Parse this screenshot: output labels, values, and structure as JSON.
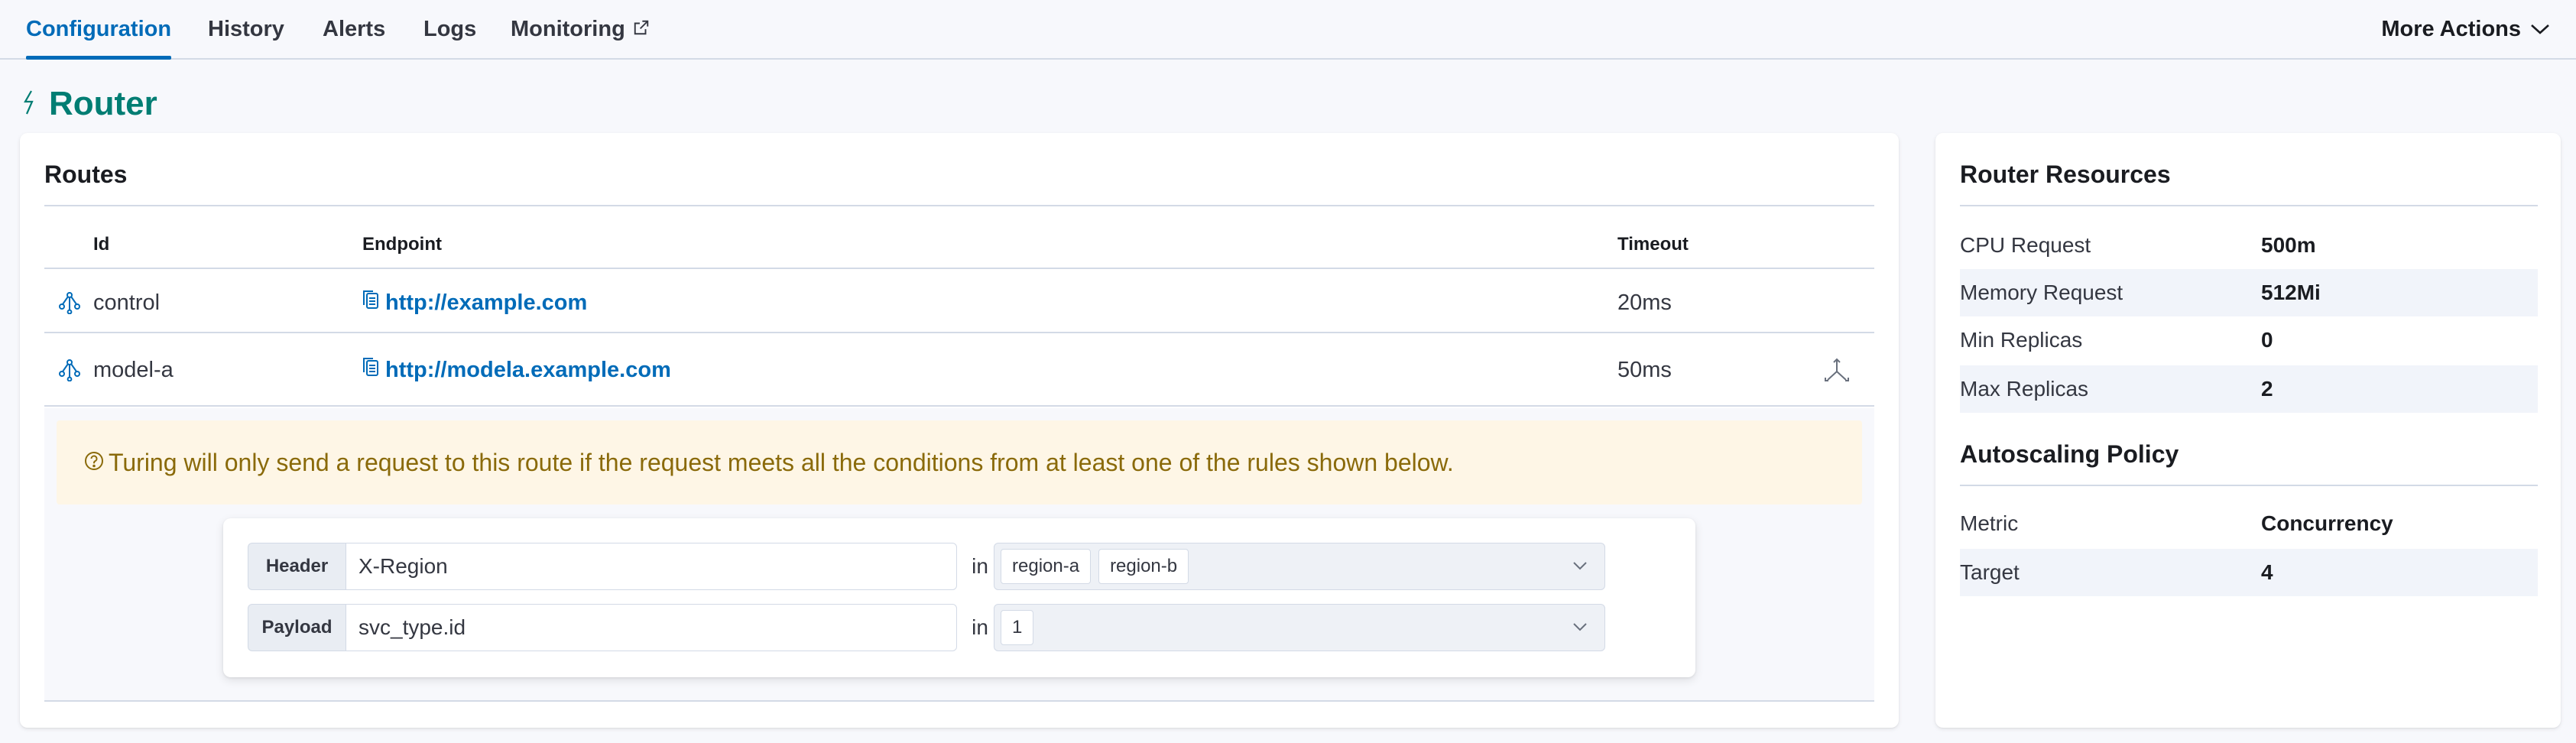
{
  "tabs": [
    {
      "label": "Configuration",
      "active": true
    },
    {
      "label": "History",
      "active": false
    },
    {
      "label": "Alerts",
      "active": false
    },
    {
      "label": "Logs",
      "active": false
    },
    {
      "label": "Monitoring",
      "active": false,
      "external": true
    }
  ],
  "more_actions": {
    "label": "More Actions"
  },
  "page": {
    "title": "Router",
    "title_icon": "bolt-icon"
  },
  "routes": {
    "heading": "Routes",
    "columns": {
      "id": "Id",
      "endpoint": "Endpoint",
      "timeout": "Timeout"
    },
    "rows": [
      {
        "id": "control",
        "endpoint": "http://example.com",
        "timeout": "20ms"
      },
      {
        "id": "model-a",
        "endpoint": "http://modela.example.com",
        "timeout": "50ms"
      }
    ],
    "callout": "Turing will only send a request to this route if the request meets all the conditions from at least one of the rules shown below.",
    "rules": [
      {
        "field_source": "Header",
        "field": "X-Region",
        "operator": "in",
        "values": [
          "region-a",
          "region-b"
        ]
      },
      {
        "field_source": "Payload",
        "field": "svc_type.id",
        "operator": "in",
        "values": [
          "1"
        ]
      }
    ]
  },
  "resources": {
    "heading": "Router Resources",
    "items": [
      {
        "label": "CPU Request",
        "value": "500m"
      },
      {
        "label": "Memory Request",
        "value": "512Mi"
      },
      {
        "label": "Min Replicas",
        "value": "0"
      },
      {
        "label": "Max Replicas",
        "value": "2"
      }
    ]
  },
  "autoscaling": {
    "heading": "Autoscaling Policy",
    "items": [
      {
        "label": "Metric",
        "value": "Concurrency"
      },
      {
        "label": "Target",
        "value": "4"
      }
    ]
  },
  "colors": {
    "accent": "#006bb8",
    "title": "#017d73",
    "callout_bg": "#fef6e6",
    "callout_text": "#8a6a0a"
  }
}
